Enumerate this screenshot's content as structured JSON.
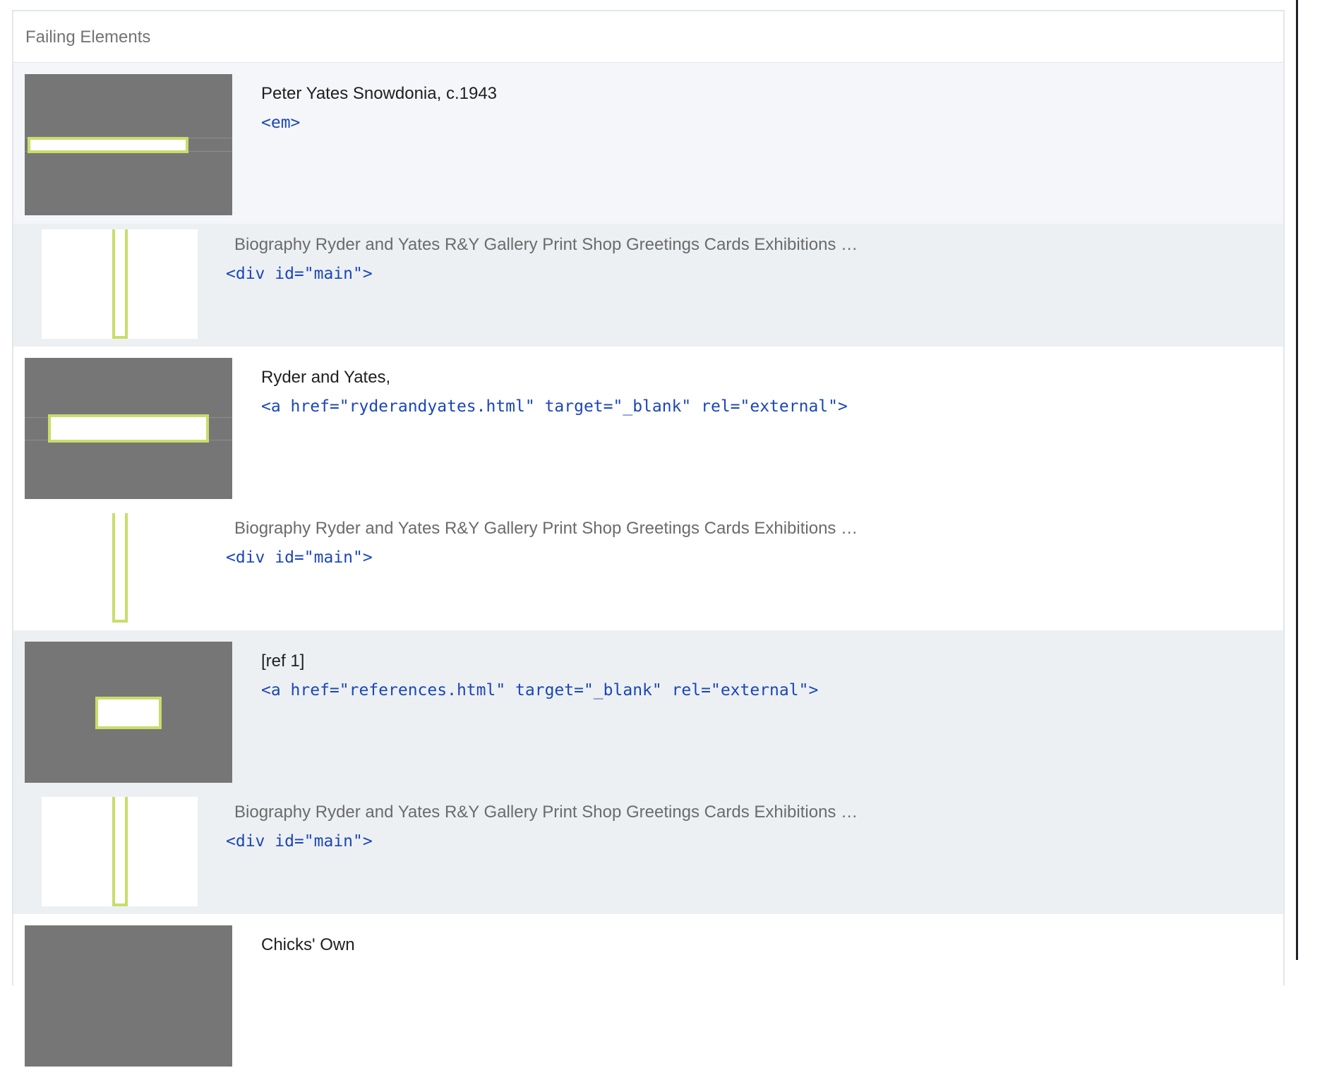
{
  "panel": {
    "title": "Failing Elements"
  },
  "items": [
    {
      "label": "Peter Yates Snowdonia, c.1943",
      "code": "<em>",
      "parent_label": "Biography Ryder and Yates R&Y Gallery Print Shop Greetings Cards Exhibitions …",
      "parent_code": "<div id=\"main\">"
    },
    {
      "label": "Ryder and Yates,",
      "code": "<a href=\"ryderandyates.html\" target=\"_blank\" rel=\"external\">",
      "parent_label": "Biography Ryder and Yates R&Y Gallery Print Shop Greetings Cards Exhibitions …",
      "parent_code": "<div id=\"main\">"
    },
    {
      "label": "[ref 1]",
      "code": "<a href=\"references.html\" target=\"_blank\" rel=\"external\">",
      "parent_label": "Biography Ryder and Yates R&Y Gallery Print Shop Greetings Cards Exhibitions …",
      "parent_code": "<div id=\"main\">"
    },
    {
      "label": "Chicks' Own"
    }
  ],
  "colors": {
    "highlight": "#c9dd6a",
    "code": "#1a46b8",
    "thumbnail": "#767676",
    "row_alt_light": "#f4f6f9",
    "row_alt_dark": "#edf0f3"
  }
}
